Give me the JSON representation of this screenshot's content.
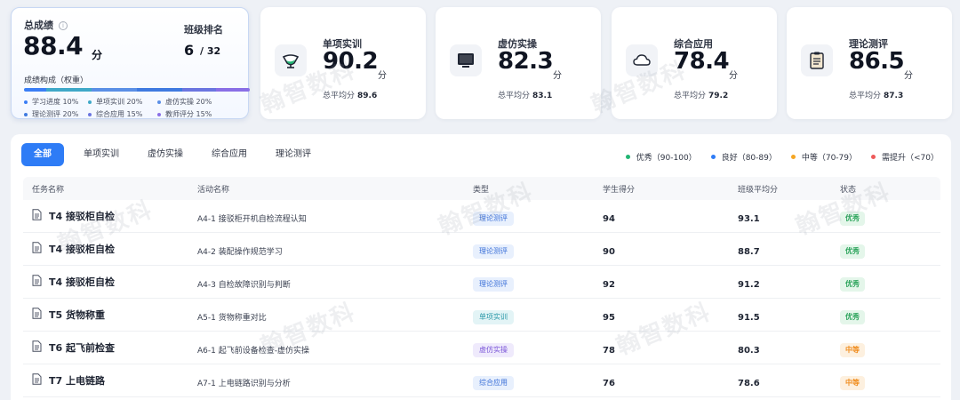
{
  "summary": {
    "label": "总成绩",
    "score": "88.4",
    "unit": "分",
    "rank_label": "班级排名",
    "rank": "6",
    "rank_total": "/ 32",
    "composition_label": "成绩构成（权重）",
    "composition": [
      {
        "label": "学习进度 10%",
        "weight": 10,
        "color": "#3a7ef5"
      },
      {
        "label": "单项实训 20%",
        "weight": 20,
        "color": "#3fa8c8"
      },
      {
        "label": "虚仿实操 20%",
        "weight": 20,
        "color": "#5a8fe6"
      },
      {
        "label": "理论测评 20%",
        "weight": 20,
        "color": "#3f7ae0"
      },
      {
        "label": "综合应用 15%",
        "weight": 15,
        "color": "#6b75e0"
      },
      {
        "label": "教师评分 15%",
        "weight": 15,
        "color": "#8a6fe6"
      }
    ]
  },
  "cards": [
    {
      "title": "单项实训",
      "score": "90.2",
      "unit": "分",
      "avg_label": "总平均分",
      "avg": "89.6",
      "icon": "flask-icon"
    },
    {
      "title": "虚仿实操",
      "score": "82.3",
      "unit": "分",
      "avg_label": "总平均分",
      "avg": "83.1",
      "icon": "monitor-icon"
    },
    {
      "title": "综合应用",
      "score": "78.4",
      "unit": "分",
      "avg_label": "总平均分",
      "avg": "79.2",
      "icon": "cloud-icon"
    },
    {
      "title": "理论测评",
      "score": "86.5",
      "unit": "分",
      "avg_label": "总平均分",
      "avg": "87.3",
      "icon": "clipboard-icon"
    }
  ],
  "tabs": [
    "全部",
    "单项实训",
    "虚仿实操",
    "综合应用",
    "理论测评"
  ],
  "grade_legend": [
    {
      "label": "优秀（90-100）",
      "color": "#22b573"
    },
    {
      "label": "良好（80-89）",
      "color": "#2e7cf6"
    },
    {
      "label": "中等（70-79）",
      "color": "#f5a623"
    },
    {
      "label": "需提升（<70）",
      "color": "#ee5a5a"
    }
  ],
  "table": {
    "headers": [
      "任务名称",
      "活动名称",
      "类型",
      "学生得分",
      "班级平均分",
      "状态"
    ],
    "rows": [
      {
        "task": "T4 接驳柜自检",
        "activity": "A4-1 接驳柜开机自检流程认知",
        "type": "理论测评",
        "score": "94",
        "avg": "93.1",
        "status": "优秀"
      },
      {
        "task": "T4 接驳柜自检",
        "activity": "A4-2 装配操作规范学习",
        "type": "理论测评",
        "score": "90",
        "avg": "88.7",
        "status": "优秀"
      },
      {
        "task": "T4 接驳柜自检",
        "activity": "A4-3 自检故障识别与判断",
        "type": "理论测评",
        "score": "92",
        "avg": "91.2",
        "status": "优秀"
      },
      {
        "task": "T5 货物称重",
        "activity": "A5-1 货物称重对比",
        "type": "单项实训",
        "score": "95",
        "avg": "91.5",
        "status": "优秀"
      },
      {
        "task": "T6 起飞前检查",
        "activity": "A6-1 起飞前设备检查-虚仿实操",
        "type": "虚仿实操",
        "score": "78",
        "avg": "80.3",
        "status": "中等"
      },
      {
        "task": "T7 上电链路",
        "activity": "A7-1 上电链路识别与分析",
        "type": "综合应用",
        "score": "76",
        "avg": "78.6",
        "status": "中等"
      }
    ]
  },
  "watermark": "翰智数科"
}
